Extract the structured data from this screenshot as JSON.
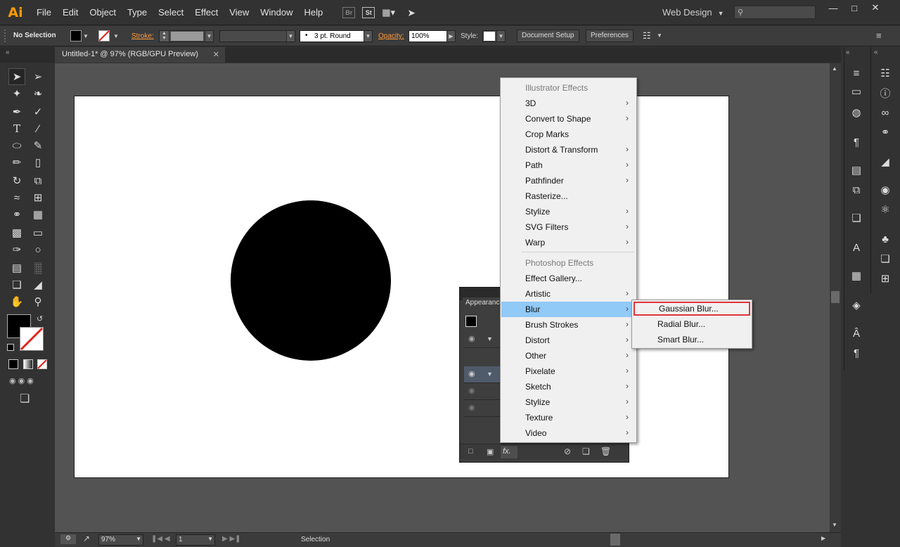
{
  "app": {
    "logo": "Ai"
  },
  "menubar": {
    "items": [
      "File",
      "Edit",
      "Object",
      "Type",
      "Select",
      "Effect",
      "View",
      "Window",
      "Help"
    ],
    "bridge_badge": "Br",
    "stock_badge": "St",
    "workspace": "Web Design",
    "window_controls": [
      "—",
      "□",
      "✕"
    ]
  },
  "controlbar": {
    "selection_label": "No Selection",
    "stroke_label": "Stroke:",
    "brush_value": "3 pt. Round",
    "opacity_label": "Opacity:",
    "opacity_value": "100%",
    "style_label": "Style:",
    "document_setup": "Document Setup",
    "preferences": "Preferences"
  },
  "document": {
    "tab_title": "Untitled-1* @ 97% (RGB/GPU Preview)",
    "close_glyph": "✕"
  },
  "statusbar": {
    "zoom": "97%",
    "page": "1",
    "current_tool": "Selection"
  },
  "appearance_panel": {
    "title": "Appearance",
    "fx_label": "fx."
  },
  "effect_menu": {
    "illustrator_header": "Illustrator Effects",
    "illustrator_items": [
      {
        "label": "3D",
        "sub": true
      },
      {
        "label": "Convert to Shape",
        "sub": true
      },
      {
        "label": "Crop Marks",
        "sub": false
      },
      {
        "label": "Distort & Transform",
        "sub": true
      },
      {
        "label": "Path",
        "sub": true
      },
      {
        "label": "Pathfinder",
        "sub": true
      },
      {
        "label": "Rasterize...",
        "sub": false
      },
      {
        "label": "Stylize",
        "sub": true
      },
      {
        "label": "SVG Filters",
        "sub": true
      },
      {
        "label": "Warp",
        "sub": true
      }
    ],
    "photoshop_header": "Photoshop Effects",
    "photoshop_items": [
      {
        "label": "Effect Gallery...",
        "sub": false
      },
      {
        "label": "Artistic",
        "sub": true
      },
      {
        "label": "Blur",
        "sub": true,
        "highlighted": true
      },
      {
        "label": "Brush Strokes",
        "sub": true
      },
      {
        "label": "Distort",
        "sub": true
      },
      {
        "label": "Other",
        "sub": true
      },
      {
        "label": "Pixelate",
        "sub": true
      },
      {
        "label": "Sketch",
        "sub": true
      },
      {
        "label": "Stylize",
        "sub": true
      },
      {
        "label": "Texture",
        "sub": true
      },
      {
        "label": "Video",
        "sub": true
      }
    ],
    "submenu_glyph": "›"
  },
  "blur_submenu": {
    "items": [
      "Gaussian Blur...",
      "Radial Blur...",
      "Smart Blur..."
    ],
    "highlight_color": "#e2323c"
  },
  "colors": {
    "accent": "#ff9a00",
    "menu_highlight": "#91c9f7"
  }
}
